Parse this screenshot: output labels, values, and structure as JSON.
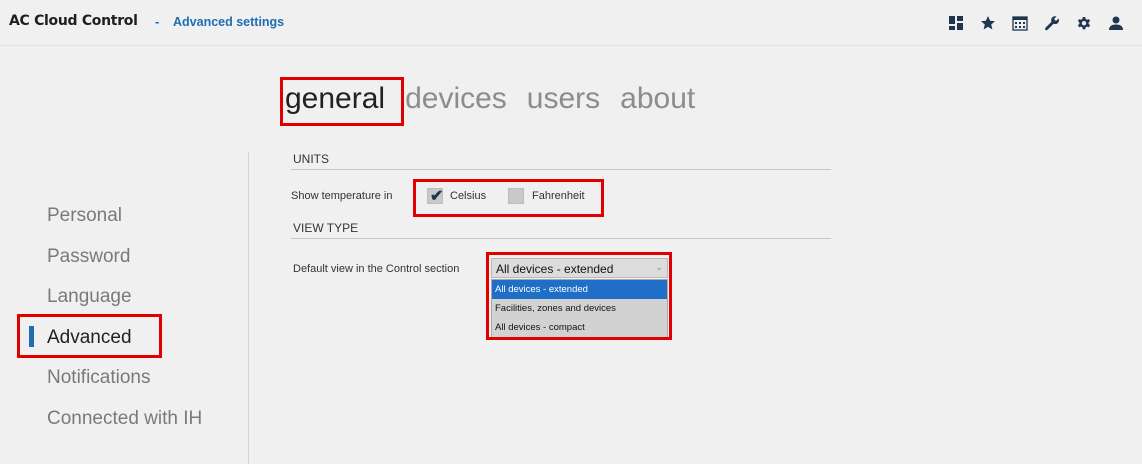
{
  "header": {
    "app_title": "AC Cloud Control",
    "separator": "-",
    "page_title": "Advanced settings",
    "tools": [
      {
        "icon": "dashboard-icon"
      },
      {
        "icon": "star-icon"
      },
      {
        "icon": "calendar-icon"
      },
      {
        "icon": "wrench-icon"
      },
      {
        "icon": "gear-icon"
      },
      {
        "icon": "user-icon"
      }
    ]
  },
  "tabs": [
    {
      "label": "general",
      "active": true
    },
    {
      "label": "devices",
      "active": false
    },
    {
      "label": "users",
      "active": false
    },
    {
      "label": "about",
      "active": false
    }
  ],
  "sidebar": {
    "items": [
      {
        "label": "Personal",
        "active": false
      },
      {
        "label": "Password",
        "active": false
      },
      {
        "label": "Language",
        "active": false
      },
      {
        "label": "Advanced",
        "active": true
      },
      {
        "label": "Notifications",
        "active": false
      },
      {
        "label": "Connected with IH",
        "active": false
      }
    ]
  },
  "units": {
    "title": "UNITS",
    "temp_label": "Show temperature in",
    "celsius": {
      "label": "Celsius",
      "checked": true
    },
    "fahrenheit": {
      "label": "Fahrenheit",
      "checked": false
    }
  },
  "view_type": {
    "title": "VIEW TYPE",
    "default_view_label": "Default view in the Control section",
    "selected": "All devices - extended",
    "options": [
      "All devices - extended",
      "Facilities, zones and devices",
      "All devices - compact"
    ]
  },
  "colors": {
    "accent": "#1f6db4",
    "highlight": "#e10000",
    "selected_option": "#1f6fc9"
  }
}
